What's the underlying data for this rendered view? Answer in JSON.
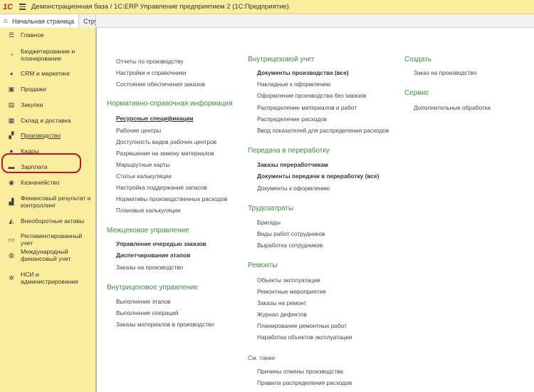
{
  "titlebar": {
    "logo": "1С",
    "title": "Демонстрационная база / 1С:ERP Управление предприятием 2  (1С:Предприятие)"
  },
  "tabs": {
    "home": "Начальная страница",
    "open": "Струк"
  },
  "sidebar": {
    "items": [
      {
        "label": "Главное",
        "icon": "☰"
      },
      {
        "label": "Бюджетирование и\nпланирование",
        "icon": "◔"
      },
      {
        "label": "CRM и маркетинг",
        "icon": "◕"
      },
      {
        "label": "Продажи",
        "icon": "▣"
      },
      {
        "label": "Закупки",
        "icon": "▤"
      },
      {
        "label": "Склад и доставка",
        "icon": "▦"
      },
      {
        "label": "Производство",
        "icon": "▞"
      },
      {
        "label": "Кадры",
        "icon": "●"
      },
      {
        "label": "Зарплата",
        "icon": "▬"
      },
      {
        "label": "Казначейство",
        "icon": "◉"
      },
      {
        "label": "Финансовый результат и\nконтроллинг",
        "icon": "▟"
      },
      {
        "label": "Внеоборотные активы",
        "icon": "◭"
      },
      {
        "label": "Регламентированный учет",
        "icon": "▭"
      },
      {
        "label": "Международный\nфинансовый учет",
        "icon": "◍"
      },
      {
        "label": "НСИ и\nадминистрирование",
        "icon": "✲"
      }
    ]
  },
  "col1": {
    "top_links": [
      "Отчеты по производству",
      "Настройки и справочники",
      "Состояние обеспечения заказов"
    ],
    "nsi_title": "Нормативно-справочная информация",
    "nsi_links": [
      "Ресурсные спецификации",
      "Рабочие центры",
      "Доступность видов рабочих центров",
      "Разрешения на замену материалов",
      "Маршрутные карты",
      "Статьи калькуляции",
      "Настройка поддержания запасов",
      "Нормативы производственных расходов",
      "Плановые калькуляции"
    ],
    "mezh_title": "Межцеховое управление",
    "mezh_links": [
      "Управление очередью заказов",
      "Диспетчирование этапов",
      "Заказы на производство"
    ],
    "vnutr_title": "Внутрицеховое управление",
    "vnutr_links": [
      "Выполнение этапов",
      "Выполнение операций",
      "Заказы материалов в производство"
    ]
  },
  "col2": {
    "uchet_title": "Внутрицеховой учет",
    "uchet_links": [
      "Документы производства (все)",
      "Накладные к оформлению",
      "Оформление производства без заказов",
      "Распределение материалов и работ",
      "Распределение расходов",
      "Ввод показателей для распределения расходов"
    ],
    "pererab_title": "Передача в переработку",
    "pererab_links": [
      "Заказы переработчикам",
      "Документы передачи в переработку (все)",
      "Документы к оформлению"
    ],
    "trud_title": "Трудозатраты",
    "trud_links": [
      "Бригады",
      "Виды работ сотрудников",
      "Выработка сотрудников"
    ],
    "remont_title": "Ремонты",
    "remont_links": [
      "Объекты эксплуатации",
      "Ремонтные мероприятия",
      "Заказы на ремонт",
      "Журнал дефектов",
      "Планирование ремонтных работ",
      "Наработка объектов эксплуатации"
    ],
    "see_also_title": "См. также",
    "see_also_links": [
      "Причины отмены производства",
      "Правила распределения расходов"
    ]
  },
  "col3": {
    "create_title": "Создать",
    "create_links": [
      "Заказ на производство"
    ],
    "service_title": "Сервис",
    "service_links": [
      "Дополнительные обработки"
    ]
  }
}
